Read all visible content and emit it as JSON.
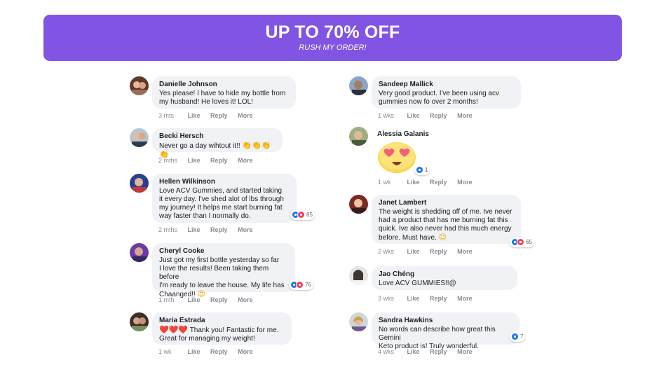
{
  "banner": {
    "title": "UP TO 70% OFF",
    "subtitle": "RUSH MY ORDER!"
  },
  "actions": {
    "like": "Like",
    "reply": "Reply",
    "more": "More"
  },
  "colors": {
    "accent": "#8254e3",
    "bubble": "#f0f2f5",
    "like": "#1877f2",
    "love": "#f33e58"
  },
  "left": [
    {
      "name": "Danielle Johnson",
      "text": "Yes please! I have to hide my bottle from\nmy husband! He loves it! LOL!",
      "time": "3 mts"
    },
    {
      "name": "Becki Hersch",
      "text": "Never go a day wihtout it!!",
      "emoji": "👏👏👏👏",
      "time": "2 mths"
    },
    {
      "name": "Hellen Wilkinson",
      "text": "Love ACV Gummies, and started taking\nit every day. I've shed alot of lbs through\nmy journey! It helps me start burning fat\nway faster than I normally do.",
      "time": "2 mths",
      "reactions": "85"
    },
    {
      "name": "Cheryl Cooke",
      "text": "Just got my first bottle yesterday so far\nI love the results! Been taking them before\nI'm ready to leave the house. My life has\nChaanged!!",
      "emoji": "😍",
      "time": "1 mth",
      "reactions": "76"
    },
    {
      "name": "Maria Estrada",
      "emoji": "❤️❤️❤️",
      "text": "Thank you! Fantastic for me.\nGreat for managing my weight!",
      "time": "1 wk"
    }
  ],
  "right": [
    {
      "name": "Sandeep Mallick",
      "text": "Very good product. I've been using acv\ngummies now fo over 2 months!",
      "time": "1 wks"
    },
    {
      "name": "Alessia Galanis",
      "time": "1 wk",
      "reactions": "1",
      "sticker": "heart-eyes-emoji"
    },
    {
      "name": "Janet Lambert",
      "text": "The weight is shedding off of me. Ive never\nhad a product that has me burning fat this\nquick. Ive also never had this much energy\nbefore. Must have.",
      "emoji": "😊",
      "time": "2 wks",
      "reactions": "65"
    },
    {
      "name": "Jao Chéng",
      "text": "Love ACV GUMMIES!!@",
      "time": "3 wks"
    },
    {
      "name": "Sandra Hawkins",
      "text": "No words can describe how great this Gemini\nKeto product is! Truly wonderful.",
      "time": "4 wks",
      "reactions": "7"
    }
  ]
}
